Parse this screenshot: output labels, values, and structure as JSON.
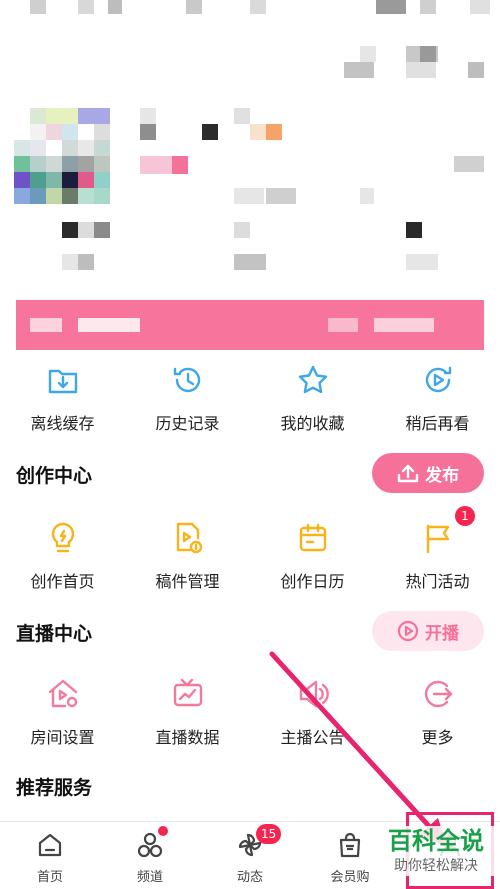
{
  "colors": {
    "accent_pink": "#f5719a",
    "blue_icon": "#3da7e8",
    "yellow_icon": "#f7b318",
    "pink_icon": "#f27a9d",
    "badge_red": "#f4254f",
    "arrow": "#e8246e",
    "watermark_green": "#1aa04a"
  },
  "quick_actions": [
    {
      "label": "离线缓存",
      "icon": "download-folder-icon"
    },
    {
      "label": "历史记录",
      "icon": "history-clock-icon"
    },
    {
      "label": "我的收藏",
      "icon": "star-icon"
    },
    {
      "label": "稍后再看",
      "icon": "watch-later-icon"
    }
  ],
  "creation_center": {
    "title": "创作中心",
    "publish_label": "发布",
    "items": [
      {
        "label": "创作首页",
        "icon": "lightbulb-icon"
      },
      {
        "label": "稿件管理",
        "icon": "manuscript-icon"
      },
      {
        "label": "创作日历",
        "icon": "calendar-icon"
      },
      {
        "label": "热门活动",
        "icon": "flag-icon",
        "badge": "1"
      }
    ]
  },
  "live_center": {
    "title": "直播中心",
    "start_label": "开播",
    "items": [
      {
        "label": "房间设置",
        "icon": "room-settings-icon"
      },
      {
        "label": "直播数据",
        "icon": "live-data-icon"
      },
      {
        "label": "主播公告",
        "icon": "announcement-icon"
      },
      {
        "label": "更多",
        "icon": "more-arrow-icon"
      }
    ]
  },
  "recommended": {
    "title": "推荐服务"
  },
  "tabbar": [
    {
      "label": "首页",
      "icon": "home-icon"
    },
    {
      "label": "频道",
      "icon": "channel-icon",
      "dot": true
    },
    {
      "label": "动态",
      "icon": "dynamic-icon",
      "badge": "15"
    },
    {
      "label": "会员购",
      "icon": "shop-bag-icon"
    },
    {
      "label": "",
      "icon": "my-icon"
    }
  ],
  "watermark": {
    "title": "百科全说",
    "subtitle": "助你轻松解决"
  }
}
